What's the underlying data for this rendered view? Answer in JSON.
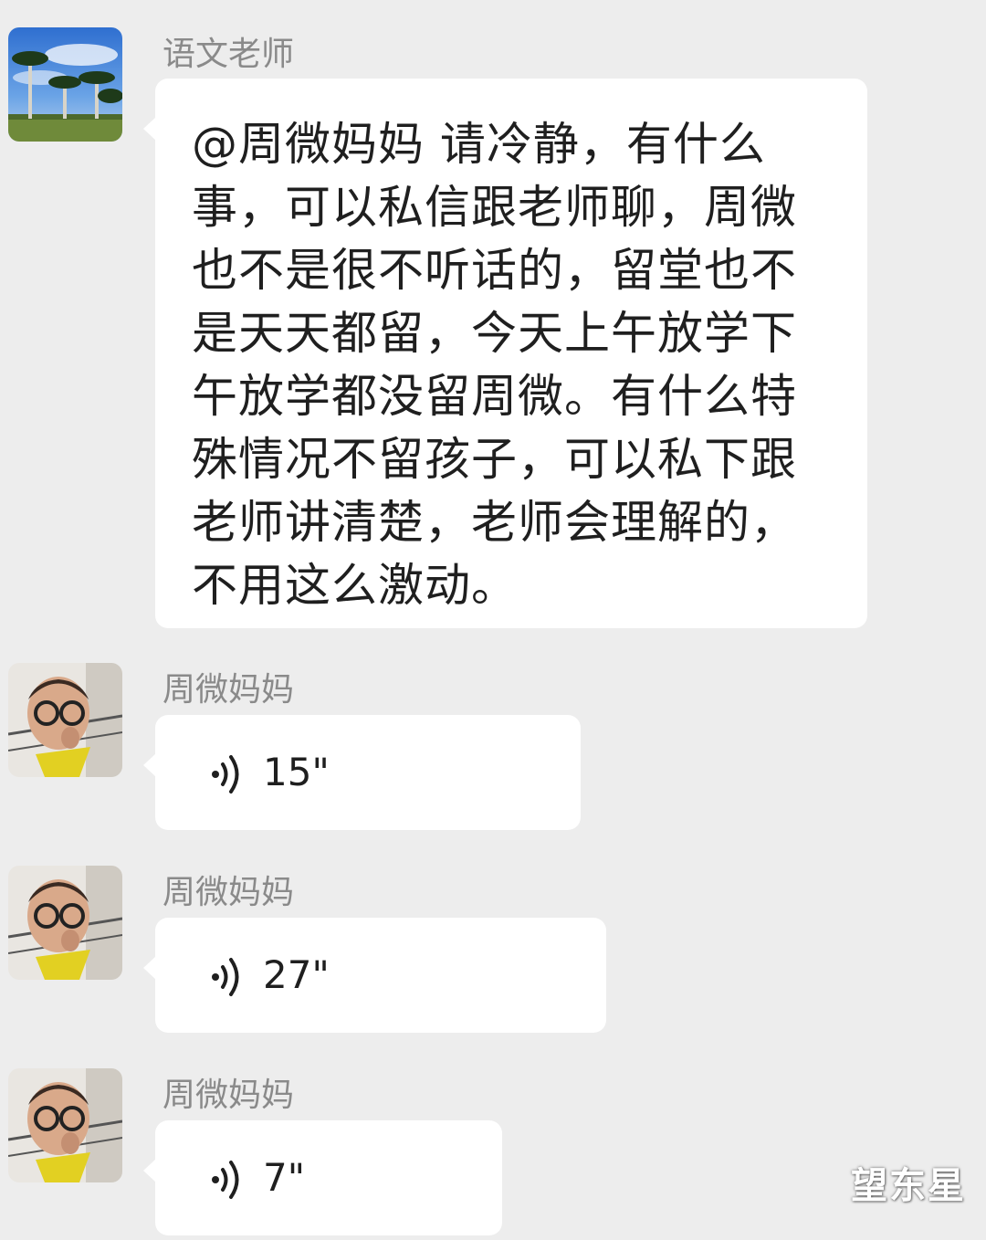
{
  "messages": [
    {
      "sender": "语文老师",
      "type": "text",
      "text": "@周微妈妈  请冷静，有什么事，可以私信跟老师聊，周微也不是很不听话的，留堂也不是天天都留，今天上午放学下午放学都没留周微。有什么特殊情况不留孩子，可以私下跟老师讲清楚，老师会理解的，不用这么激动。"
    },
    {
      "sender": "周微妈妈",
      "type": "voice",
      "duration": "15\""
    },
    {
      "sender": "周微妈妈",
      "type": "voice",
      "duration": "27\""
    },
    {
      "sender": "周微妈妈",
      "type": "voice",
      "duration": "7\""
    }
  ],
  "watermark": "望东星",
  "icons": {
    "teacher_avatar": "palm-trees-avatar",
    "parent_avatar": "child-glasses-avatar",
    "voice": "voice-wave-icon"
  },
  "colors": {
    "background": "#ededed",
    "bubble": "#ffffff",
    "sender": "#8a8a8a",
    "text": "#1f1f1f"
  }
}
